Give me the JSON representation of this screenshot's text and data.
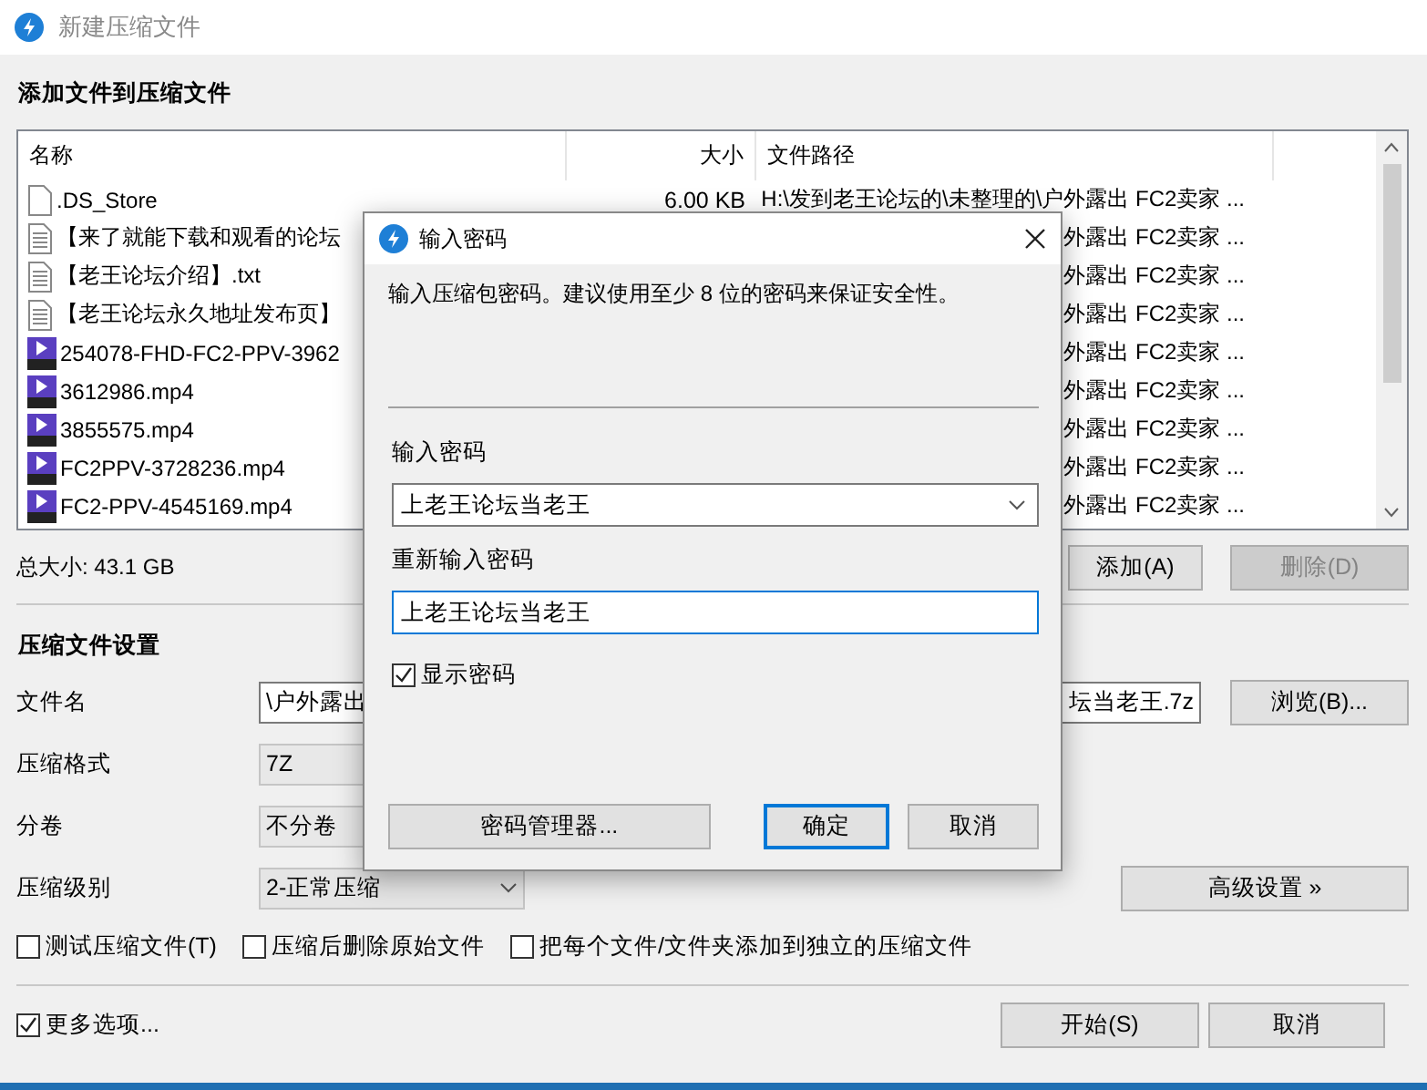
{
  "window": {
    "title": "新建压缩文件"
  },
  "files_section": {
    "heading": "添加文件到压缩文件",
    "columns": [
      "名称",
      "大小",
      "文件路径"
    ],
    "rows": [
      {
        "kind": "file",
        "name": ".DS_Store",
        "size": "6.00 KB",
        "path": "H:\\发到老王论坛的\\未整理的\\户外露出 FC2卖家 ..."
      },
      {
        "kind": "text",
        "name": "【来了就能下载和观看的论坛",
        "path": "外露出 FC2卖家 ..."
      },
      {
        "kind": "text",
        "name": "【老王论坛介绍】.txt",
        "path": "外露出 FC2卖家 ..."
      },
      {
        "kind": "text",
        "name": "【老王论坛永久地址发布页】",
        "path": "外露出 FC2卖家 ..."
      },
      {
        "kind": "video",
        "name": "254078-FHD-FC2-PPV-3962",
        "path": "外露出 FC2卖家 ..."
      },
      {
        "kind": "video",
        "name": "3612986.mp4",
        "path": "外露出 FC2卖家 ..."
      },
      {
        "kind": "video",
        "name": "3855575.mp4",
        "path": "外露出 FC2卖家 ..."
      },
      {
        "kind": "video",
        "name": "FC2PPV-3728236.mp4",
        "path": "外露出 FC2卖家 ..."
      },
      {
        "kind": "video",
        "name": "FC2-PPV-4545169.mp4",
        "path": "外露出 FC2卖家 ..."
      }
    ],
    "total": "总大小: 43.1 GB",
    "buttons": [
      {
        "label": "添加(A)",
        "disabled": false
      },
      {
        "label": "删除(D)",
        "disabled": true
      }
    ]
  },
  "settings": {
    "heading": "压缩文件设置",
    "fields": [
      {
        "kind": "text",
        "label": "文件名",
        "value_start": "\\户外露出",
        "value_end": "坛当老王.7z",
        "button": "浏览(B)..."
      },
      {
        "kind": "select",
        "label": "压缩格式",
        "value": "7Z"
      },
      {
        "kind": "select",
        "label": "分卷",
        "value": "不分卷"
      },
      {
        "kind": "dropdown",
        "label": "压缩级别",
        "value": "2-正常压缩",
        "button": "高级设置 »"
      }
    ],
    "options": [
      {
        "label": "测试压缩文件(T)",
        "checked": false
      },
      {
        "label": "压缩后删除原始文件",
        "checked": false
      },
      {
        "label": "把每个文件/文件夹添加到独立的压缩文件",
        "checked": false
      }
    ]
  },
  "footer": {
    "more": {
      "label": "更多选项...",
      "checked": true
    },
    "buttons": [
      "开始(S)",
      "取消"
    ]
  },
  "dialog": {
    "title": "输入密码",
    "message": "输入压缩包密码。建议使用至少 8 位的密码来保证安全性。",
    "password_label": "输入密码",
    "password": "上老王论坛当老王",
    "confirm_label": "重新输入密码",
    "confirm": "上老王论坛当老王",
    "show_password": {
      "label": "显示密码",
      "checked": true
    },
    "buttons": [
      {
        "label": "密码管理器...",
        "default": false
      },
      {
        "label": "确定",
        "default": true
      },
      {
        "label": "取消",
        "default": false
      }
    ]
  }
}
